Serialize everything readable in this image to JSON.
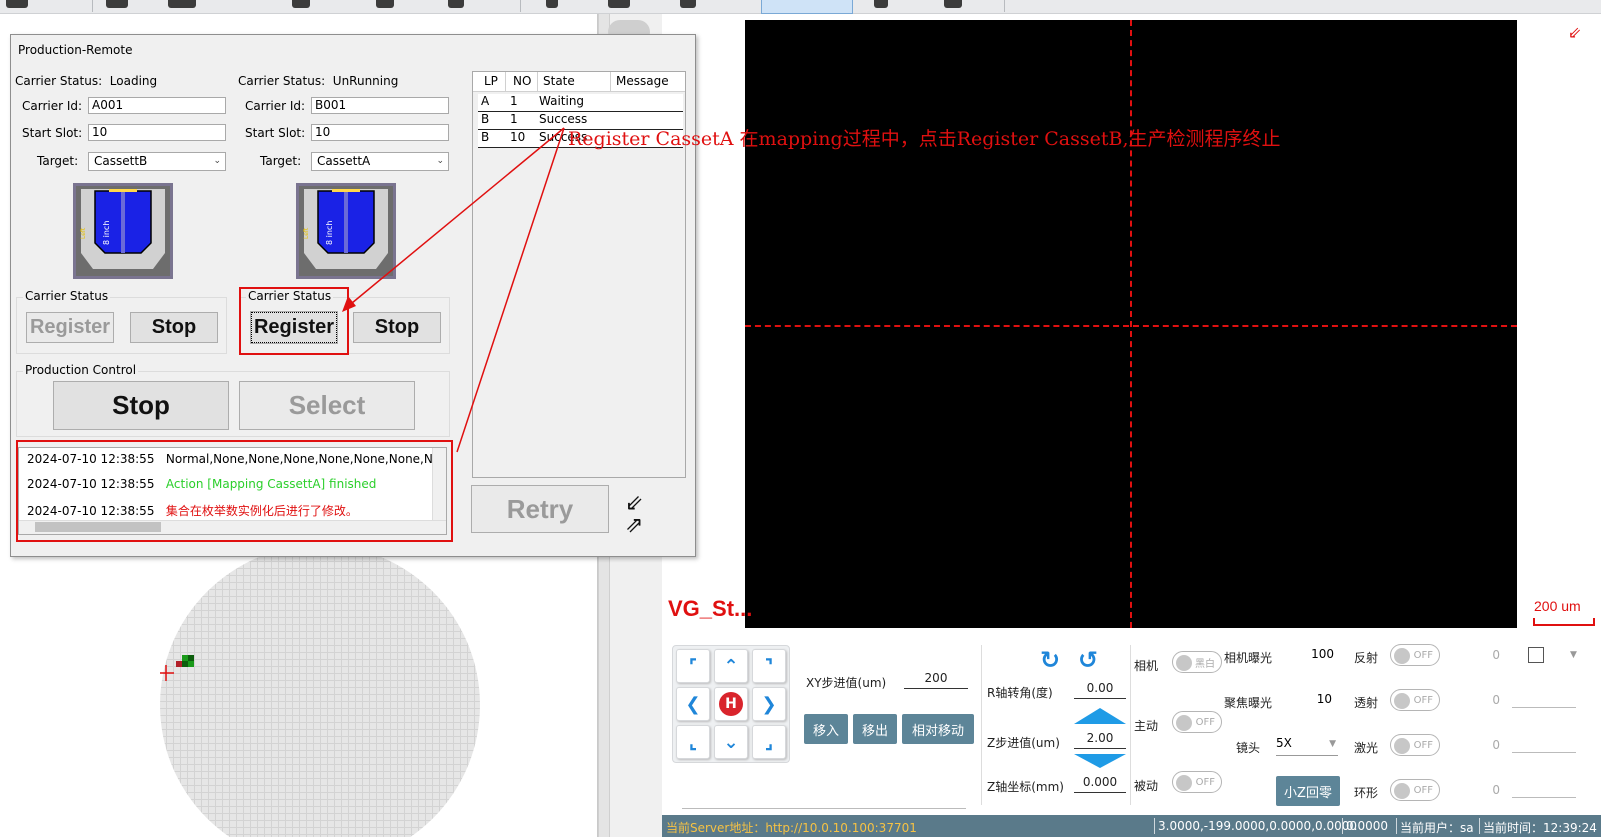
{
  "dialog": {
    "title": "Production-Remote",
    "left": {
      "carrier_status_label": "Carrier Status:",
      "carrier_status_value": "Loading",
      "carrier_id_label": "Carrier Id:",
      "carrier_id_value": "A001",
      "start_slot_label": "Start Slot:",
      "start_slot_value": "10",
      "target_label": "Target:",
      "target_value": "CassettB",
      "cassette_size": "8 inch",
      "cassette_side": "Left",
      "group_label": "Carrier Status",
      "register_label": "Register",
      "stop_label": "Stop"
    },
    "right": {
      "carrier_status_label": "Carrier Status:",
      "carrier_status_value": "UnRunning",
      "carrier_id_label": "Carrier Id:",
      "carrier_id_value": "B001",
      "start_slot_label": "Start Slot:",
      "start_slot_value": "10",
      "target_label": "Target:",
      "target_value": "CassettA",
      "cassette_size": "8 inch",
      "cassette_side": "Left",
      "group_label": "Carrier Status",
      "register_label": "Register",
      "stop_label": "Stop"
    },
    "production_control": {
      "label": "Production Control",
      "stop_label": "Stop",
      "select_label": "Select"
    },
    "log": [
      {
        "time": "2024-07-10 12:38:55",
        "message": "Normal,None,None,None,None,None,None,None",
        "color": "#000000"
      },
      {
        "time": "2024-07-10 12:38:55",
        "message": "Action [Mapping CassettA] finished",
        "color": "#2bcf2b"
      },
      {
        "time": "2024-07-10 12:38:55",
        "message": "集合在枚举数实例化后进行了修改。",
        "color": "#e01010"
      }
    ],
    "table": {
      "headers": [
        "LP",
        "NO",
        "State",
        "Message"
      ],
      "rows": [
        {
          "lp": "A",
          "no": "1",
          "state": "Waiting",
          "message": ""
        },
        {
          "lp": "B",
          "no": "1",
          "state": "Success",
          "message": ""
        },
        {
          "lp": "B",
          "no": "10",
          "state": "Success",
          "message": ""
        }
      ]
    },
    "retry_label": "Retry"
  },
  "annotation": "Register CassetA 在mapping过程中，点击Register CassetB,生产检测程序终止",
  "viewer": {
    "label": "VG_St...",
    "scale": "200 um"
  },
  "controls": {
    "home_label": "H",
    "xy_step_label": "XY步进值(um)",
    "xy_step_value": "200",
    "move_in": "移入",
    "move_out": "移出",
    "relative_move": "相对移动",
    "r_angle_label": "R轴转角(度)",
    "r_angle_value": "0.00",
    "z_step_label": "Z步进值(um)",
    "z_step_value": "2.00",
    "z_coord_label": "Z轴坐标(mm)",
    "z_coord_value": "0.000",
    "camera_label": "相机",
    "camera_toggle": "黑白",
    "active_label": "主动",
    "active_toggle": "OFF",
    "passive_label": "被动",
    "passive_toggle": "OFF",
    "cam_exposure_label": "相机曝光",
    "cam_exposure_value": "100",
    "focus_exposure_label": "聚焦曝光",
    "focus_exposure_value": "10",
    "lens_label": "镜头",
    "lens_value": "5X",
    "small_z_home": "小Z回零",
    "reflect_label": "反射",
    "transmit_label": "透射",
    "laser_label": "激光",
    "ring_label": "环形",
    "off_text": "OFF",
    "light_value": "0"
  },
  "status": {
    "server_label": "当前Server地址：http://10.0.10.100:37701",
    "coords": "3.0000,-199.0000,0.0000,0.0000",
    "value": "0.0000",
    "user": "当前用户：sa",
    "time": "当前时间：12:39:24"
  },
  "colors": {
    "accent_red": "#e01010",
    "status_bar": "#5a7a8a",
    "button_blue": "#5d8598",
    "cassette_blue": "#1020e0"
  }
}
